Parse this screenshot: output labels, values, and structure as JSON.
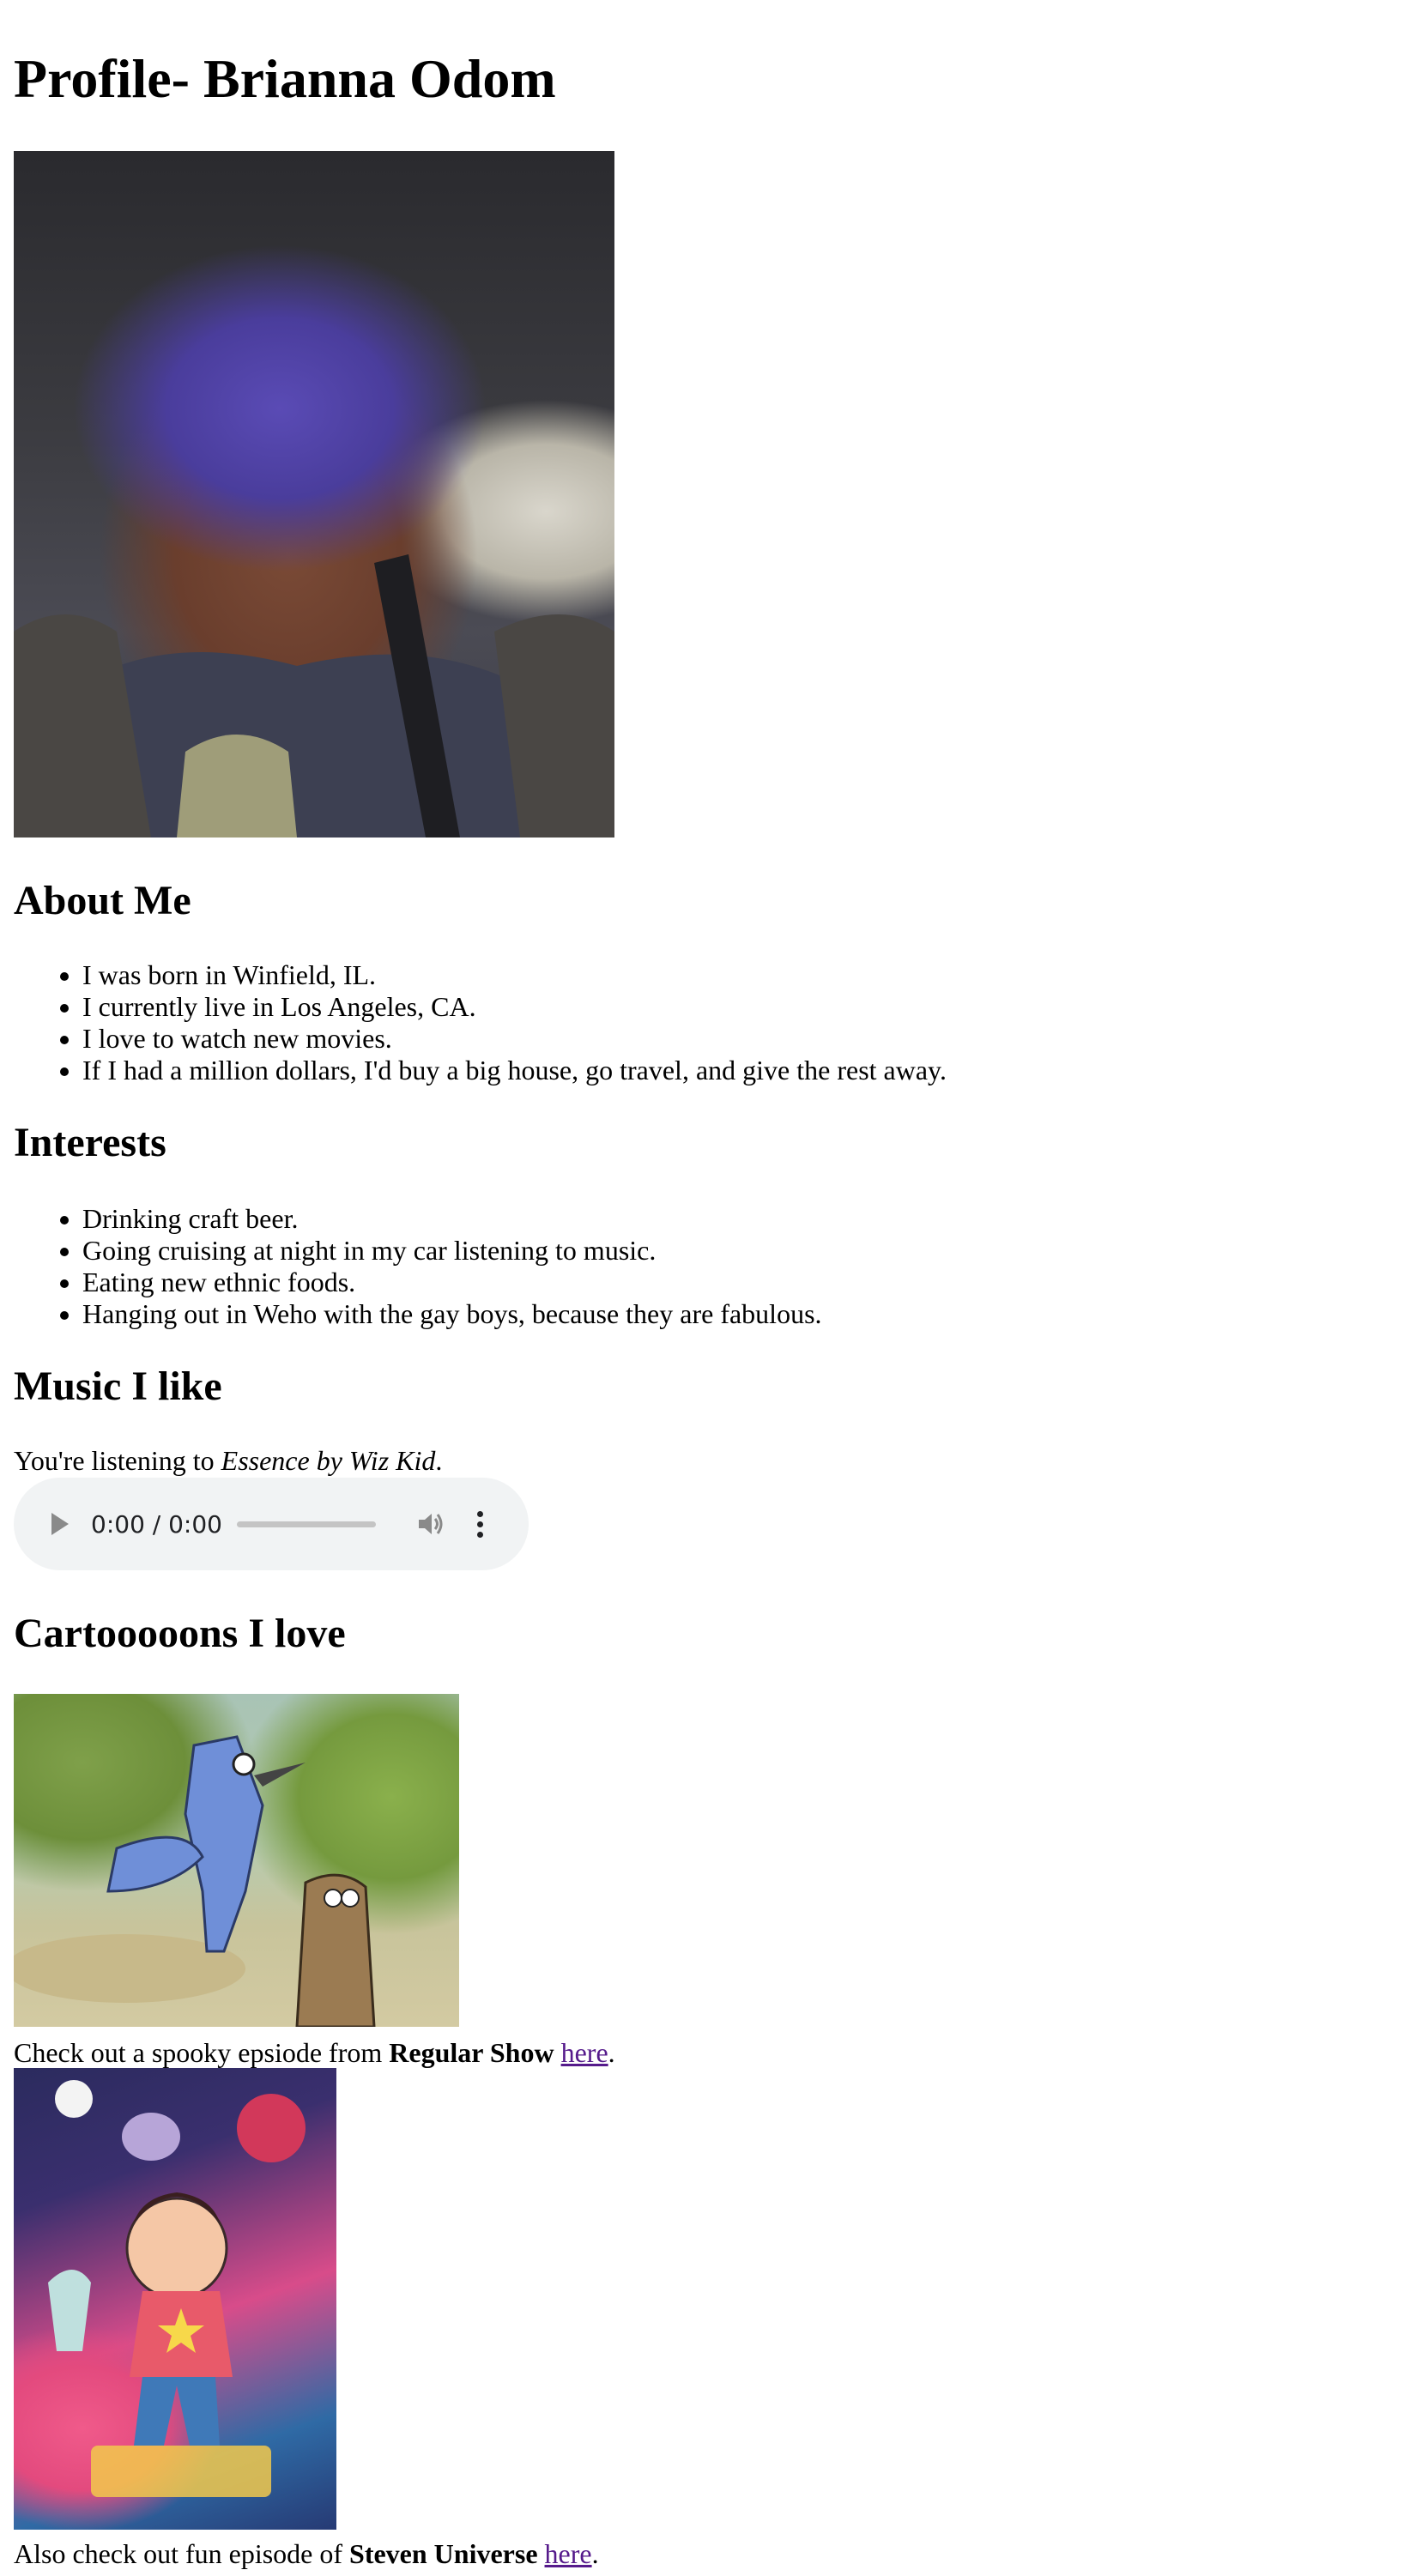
{
  "page": {
    "title": "Profile- Brianna Odom"
  },
  "profile_photo": {
    "alt": "Profile photo"
  },
  "about": {
    "heading": "About Me",
    "items": [
      "I was born in Winfield, IL.",
      "I currently live in Los Angeles, CA.",
      "I love to watch new movies.",
      "If I had a million dollars, I'd buy a big house, go travel, and give the rest away."
    ]
  },
  "interests": {
    "heading": "Interests",
    "items": [
      "Drinking craft beer.",
      "Going cruising at night in my car listening to music.",
      "Eating new ethnic foods.",
      "Hanging out in Weho with the gay boys, because they are fabulous."
    ]
  },
  "music": {
    "heading": "Music I like",
    "listening_prefix": "You're listening to ",
    "song": "Essence by Wiz Kid",
    "listening_suffix": ".",
    "player": {
      "time": "0:00 / 0:00",
      "icons": [
        "play-icon",
        "volume-icon",
        "more-options-icon"
      ]
    }
  },
  "cartoons": {
    "heading": "Cartooooons I love",
    "regular_show": {
      "prefix": "Check out a spooky epsiode from ",
      "show": "Regular Show",
      "link": "here",
      "suffix": "."
    },
    "steven_universe": {
      "prefix": "Also check out fun episode of ",
      "show": "Steven Universe",
      "link": "here",
      "suffix": "."
    }
  }
}
